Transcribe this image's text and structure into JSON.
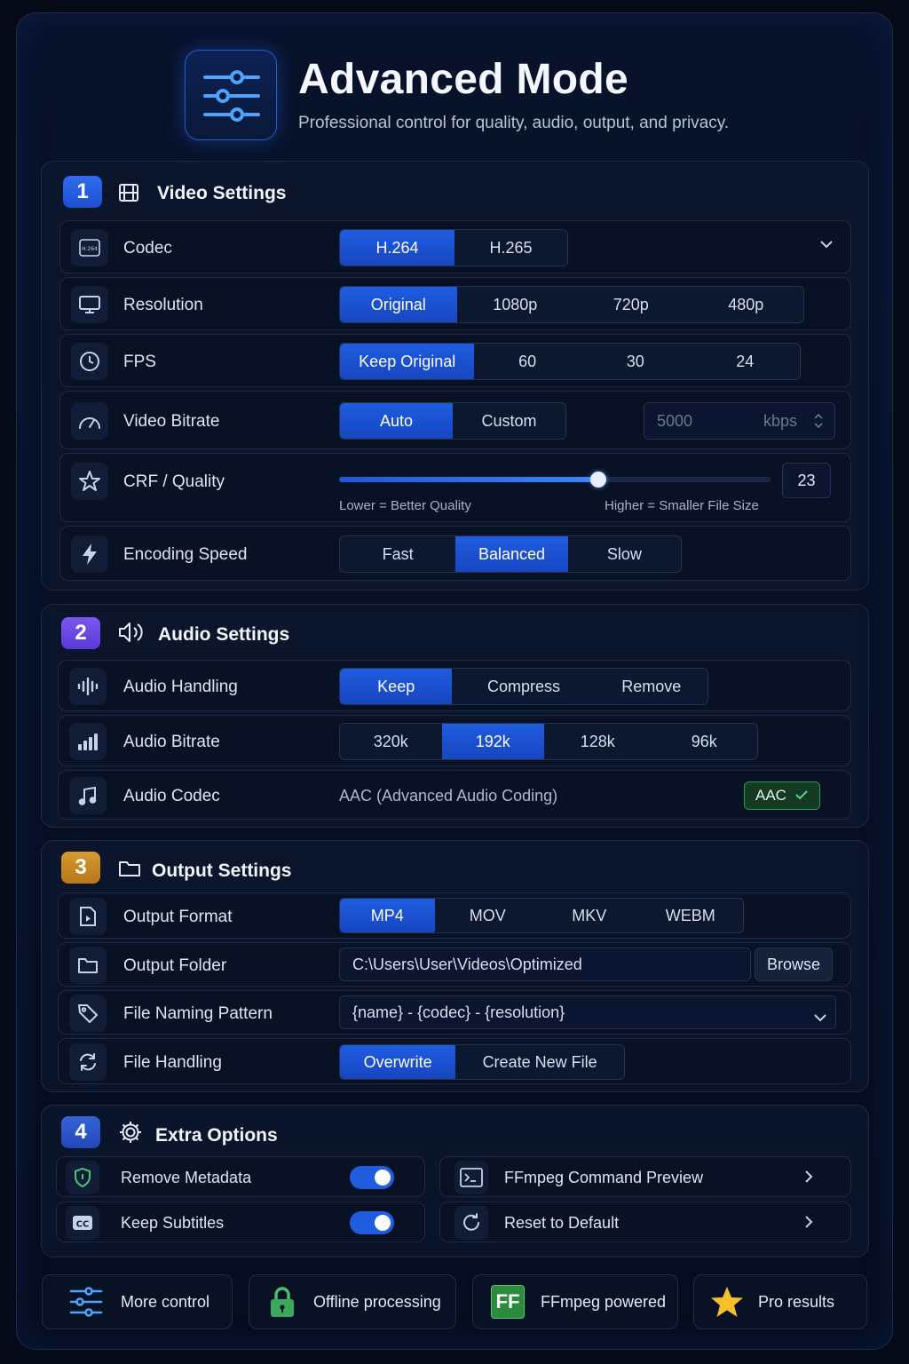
{
  "header": {
    "title": "Advanced Mode",
    "subtitle": "Professional control for quality, audio, output, and privacy.",
    "icon": "sliders-icon"
  },
  "video": {
    "number": "1",
    "title": "Video Settings",
    "codec": {
      "label": "Codec",
      "options": [
        "H.264",
        "H.265"
      ],
      "selected": "H.264"
    },
    "resolution": {
      "label": "Resolution",
      "options": [
        "Original",
        "1080p",
        "720p",
        "480p"
      ],
      "selected": "Original"
    },
    "fps": {
      "label": "FPS",
      "options": [
        "Keep Original",
        "60",
        "30",
        "24"
      ],
      "selected": "Keep Original"
    },
    "bitrate": {
      "label": "Video Bitrate",
      "options": [
        "Auto",
        "Custom"
      ],
      "selected": "Auto",
      "value": "5000",
      "unit": "kbps"
    },
    "crf": {
      "label": "CRF / Quality",
      "value": "23",
      "level": 0.6,
      "low_hint": "Lower = Better Quality",
      "high_hint": "Higher = Smaller File Size"
    },
    "speed": {
      "label": "Encoding Speed",
      "options": [
        "Fast",
        "Balanced",
        "Slow"
      ],
      "selected": "Balanced"
    }
  },
  "audio": {
    "number": "2",
    "title": "Audio Settings",
    "handling": {
      "label": "Audio Handling",
      "options": [
        "Keep",
        "Compress",
        "Remove"
      ],
      "selected": "Keep"
    },
    "bitrate": {
      "label": "Audio Bitrate",
      "options": [
        "320k",
        "192k",
        "128k",
        "96k"
      ],
      "selected": "192k"
    },
    "codec": {
      "label": "Audio Codec",
      "value": "AAC (Advanced Audio Coding)",
      "badge": "AAC"
    }
  },
  "output": {
    "number": "3",
    "title": "Output Settings",
    "format": {
      "label": "Output Format",
      "options": [
        "MP4",
        "MOV",
        "MKV",
        "WEBM"
      ],
      "selected": "MP4"
    },
    "folder": {
      "label": "Output Folder",
      "path": "C:\\Users\\User\\Videos\\Optimized",
      "browse": "Browse"
    },
    "naming": {
      "label": "File Naming Pattern",
      "value": "{name} - {codec} - {resolution}"
    },
    "handling": {
      "label": "File Handling",
      "options": [
        "Overwrite",
        "Create New File"
      ],
      "selected": "Overwrite"
    }
  },
  "extra": {
    "number": "4",
    "title": "Extra Options",
    "remove_metadata": {
      "label": "Remove Metadata",
      "on": true
    },
    "keep_subtitles": {
      "label": "Keep Subtitles",
      "on": true
    },
    "ffmpeg_preview": {
      "label": "FFmpeg Command Preview"
    },
    "reset": {
      "label": "Reset to Default"
    }
  },
  "features": [
    {
      "label": "More control",
      "icon": "sliders-icon"
    },
    {
      "label": "Offline processing",
      "icon": "lock-icon"
    },
    {
      "label": "FFmpeg powered",
      "icon": "ff-logo-icon",
      "badge": "FF"
    },
    {
      "label": "Pro results",
      "icon": "star-icon"
    }
  ],
  "colors": {
    "accent": "#1f5ce0",
    "section1": "#1f5ce0",
    "section2": "#6a45e6",
    "section3": "#c7861e",
    "section4": "#2a55c8",
    "success": "#2f9a4e"
  }
}
